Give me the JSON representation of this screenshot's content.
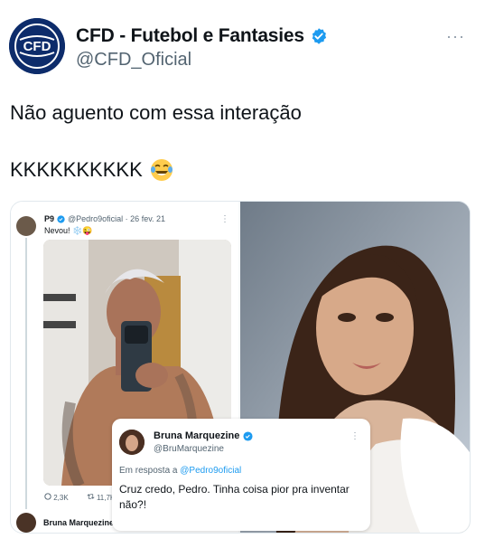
{
  "tweet": {
    "display_name": "CFD - Futebol e Fantasies",
    "handle": "@CFD_Oficial",
    "avatar_text": "CFD",
    "line1": "Não aguento com essa interação",
    "line2": "KKKKKKKKKK",
    "more_label": "···",
    "emoji": "laughing-tears-emoji",
    "accent": "#1d9bf0"
  },
  "embedded_tweet": {
    "name": "P9",
    "meta": "@Pedro9oficial · 26 fev. 21",
    "text": "Nevou! ❄️😜",
    "replies": "2,3K",
    "retweets": "11,7K",
    "more_label": "⋮"
  },
  "bottom_reply": {
    "name": "Bruna Marquezine",
    "more_label": "⋮"
  },
  "reply_card": {
    "name": "Bruna Marquezine",
    "handle": "@BruMarquezine",
    "reply_prefix": "Em resposta a",
    "reply_to": "@Pedro9oficial",
    "text": "Cruz credo, Pedro. Tinha coisa pior pra inventar não?!",
    "more_label": "⋮"
  }
}
